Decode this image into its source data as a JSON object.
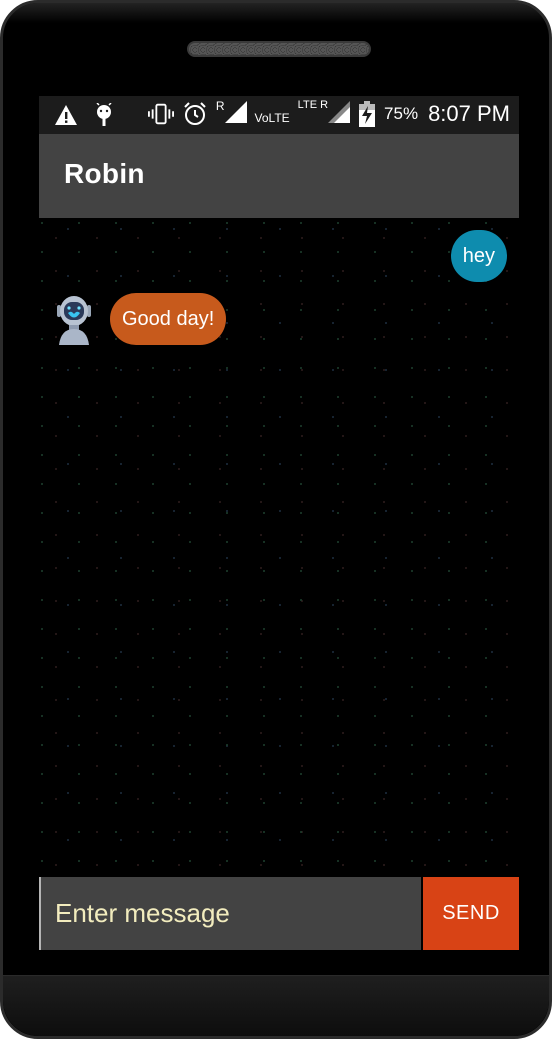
{
  "status_bar": {
    "icons_left": [
      "warning-icon",
      "android-debug-icon"
    ],
    "icons_right": [
      "vibrate-icon",
      "alarm-icon",
      "signal-icon",
      "volte-signal-icon",
      "battery-charging-icon"
    ],
    "roaming_label": "R",
    "volte_label": "VoLTE",
    "lte_label": "LTE R",
    "battery_percent": "75%",
    "time": "8:07 PM"
  },
  "app_bar": {
    "title": "Robin"
  },
  "messages": [
    {
      "sender": "user",
      "text": "hey"
    },
    {
      "sender": "bot",
      "text": "Good day!",
      "avatar": "robot-avatar-icon"
    }
  ],
  "composer": {
    "placeholder": "Enter message",
    "value": "",
    "send_label": "SEND"
  },
  "colors": {
    "app_bar": "#434343",
    "user_bubble": "#0e8cae",
    "bot_bubble": "#c75a1c",
    "send_button": "#d84315",
    "placeholder": "#f2ecbe"
  }
}
